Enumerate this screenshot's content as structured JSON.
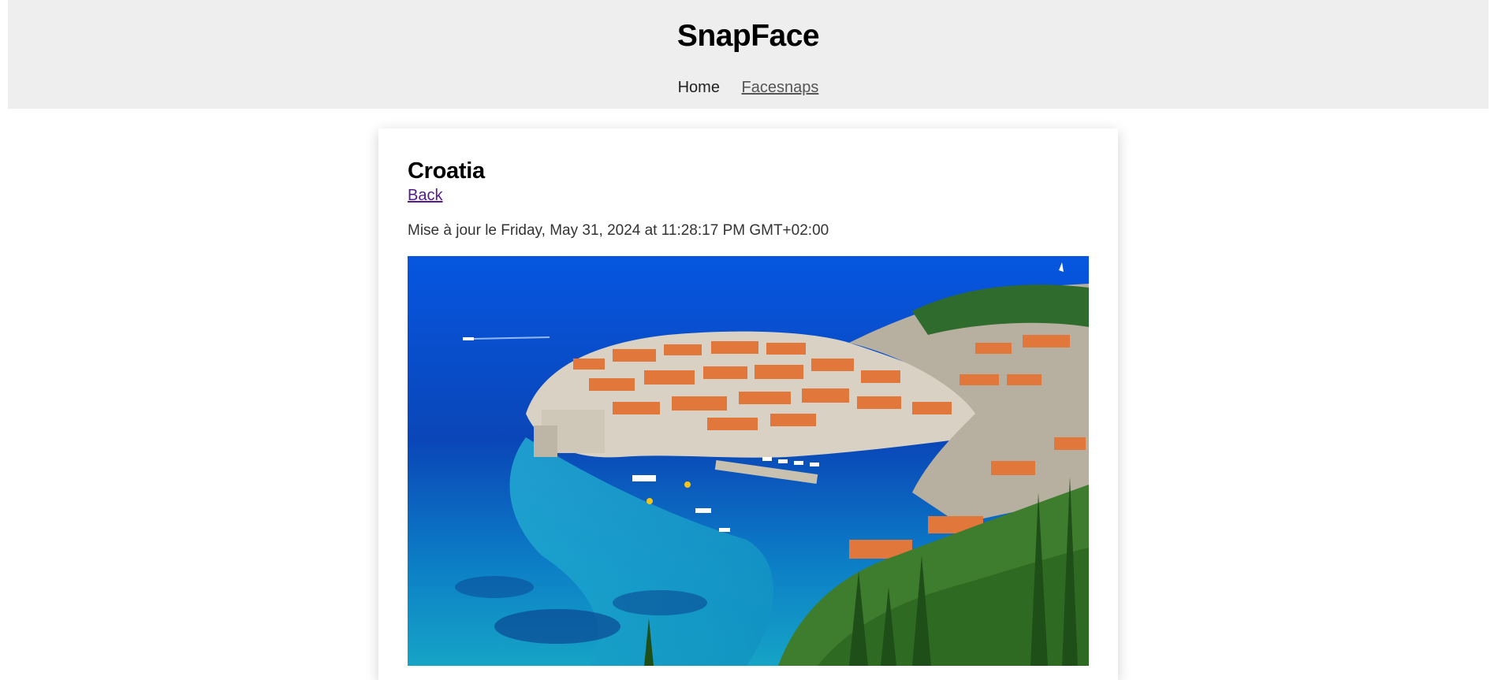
{
  "header": {
    "site_title": "SnapFace",
    "nav": {
      "home": "Home",
      "facesnaps": "Facesnaps"
    }
  },
  "snap": {
    "title": "Croatia",
    "back_label": "Back",
    "updated_text": "Mise à jour le Friday, May 31, 2024 at 11:28:17 PM GMT+02:00",
    "image_alt": "Aerial view of Dubrovnik old town"
  },
  "colors": {
    "header_bg": "#eeeeee",
    "link_visited": "#551a8b"
  }
}
